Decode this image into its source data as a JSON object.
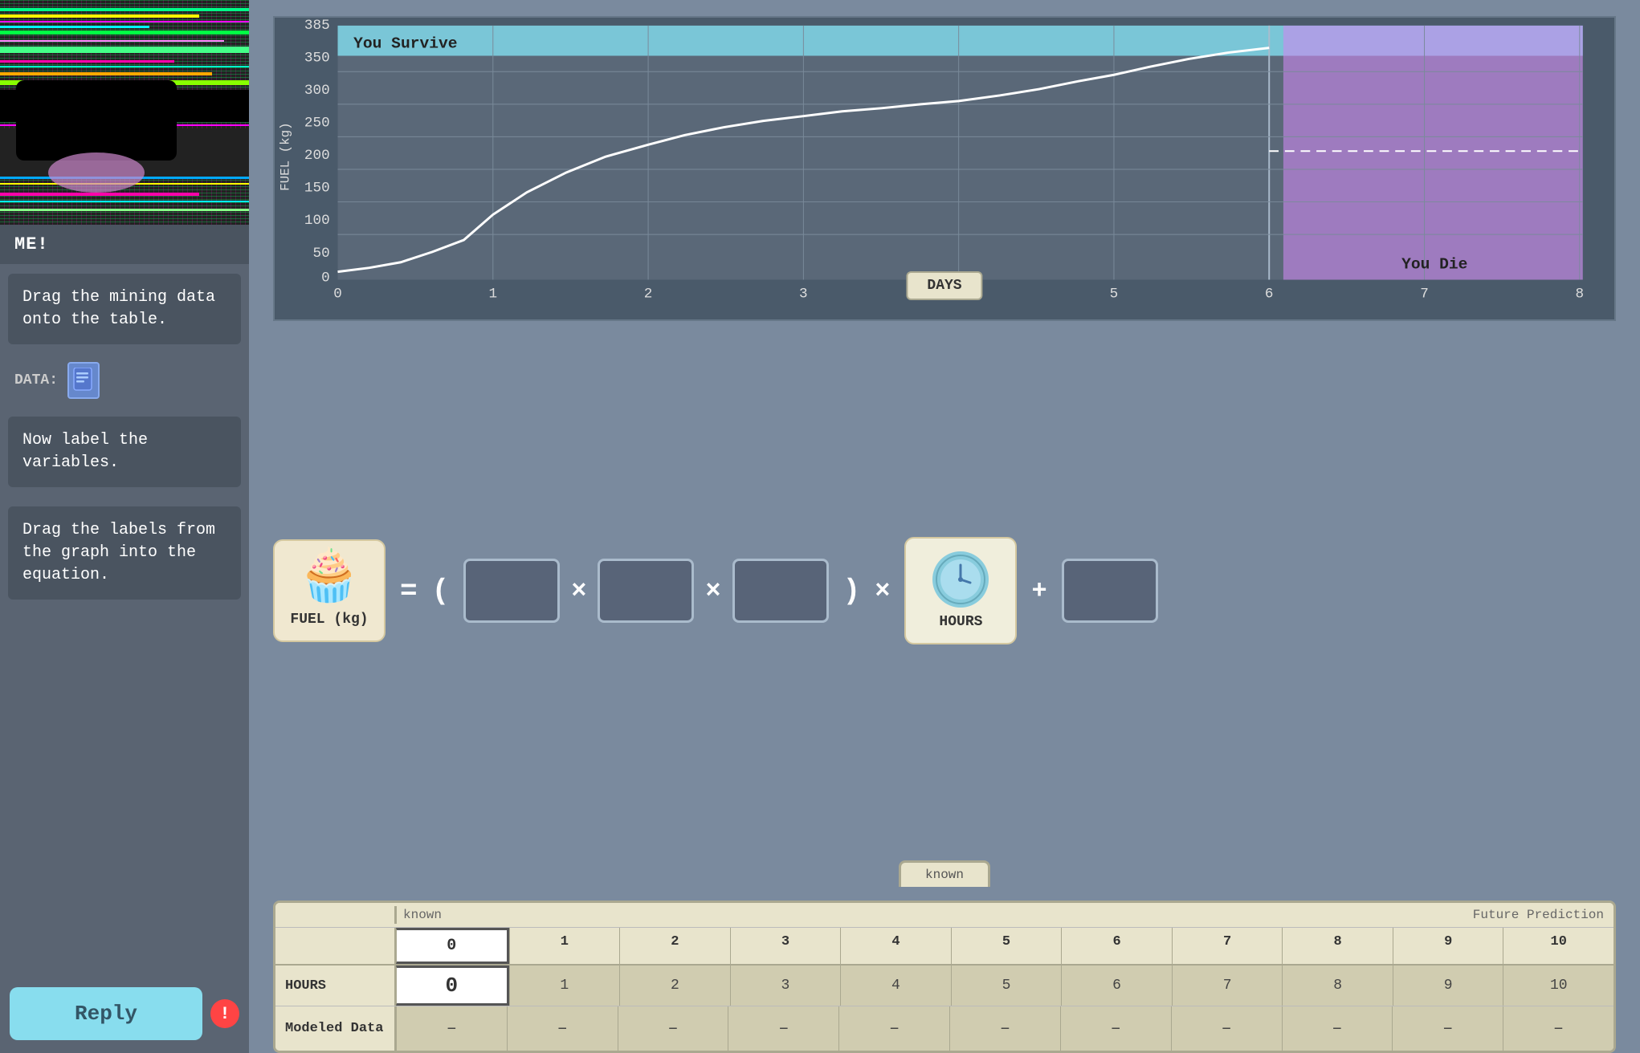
{
  "sidebar": {
    "me_label": "ME!",
    "chat_messages": [
      {
        "id": "msg1",
        "text": "Drag the mining data onto the table."
      },
      {
        "id": "msg2",
        "text": "Now label the variables."
      },
      {
        "id": "msg3",
        "text": "Drag the labels from the graph into the equation."
      }
    ],
    "data_label": "DATA:",
    "reply_button_label": "Reply",
    "exclamation": "!"
  },
  "graph": {
    "title": "You Survive",
    "y_axis_label": "FUEL (kg)",
    "x_axis_label": "DAYS",
    "y_max": 385,
    "y_ticks": [
      0,
      50,
      100,
      150,
      200,
      250,
      300,
      350,
      385
    ],
    "x_ticks": [
      0,
      1,
      2,
      3,
      4,
      5,
      6,
      7,
      8
    ],
    "survive_zone_color": "#88eeff",
    "die_zone_color": "#cc88ee",
    "die_label": "You Die",
    "dashed_y_value": 210
  },
  "equation": {
    "fuel_label": "FUEL (kg)",
    "hours_label": "HOURS",
    "eq_sign": "=",
    "open_paren": "(",
    "times1": "×",
    "times2": "×",
    "close_paren": ")",
    "times3": "×",
    "plus": "+"
  },
  "table": {
    "tab_text": "known",
    "known_label": "known",
    "future_label": "Future Prediction",
    "row_labels": [
      "HOURS",
      "Modeled Data"
    ],
    "col_headers": [
      "0",
      "1",
      "2",
      "3",
      "4",
      "5",
      "6",
      "7",
      "8",
      "9",
      "10"
    ],
    "col_highlighted_index": 0,
    "row_data": [
      [
        "0",
        "1",
        "2",
        "3",
        "4",
        "5",
        "6",
        "7",
        "8",
        "9",
        "10"
      ],
      [
        "–",
        "–",
        "–",
        "–",
        "–",
        "–",
        "–",
        "–",
        "–",
        "–",
        "–"
      ]
    ]
  }
}
